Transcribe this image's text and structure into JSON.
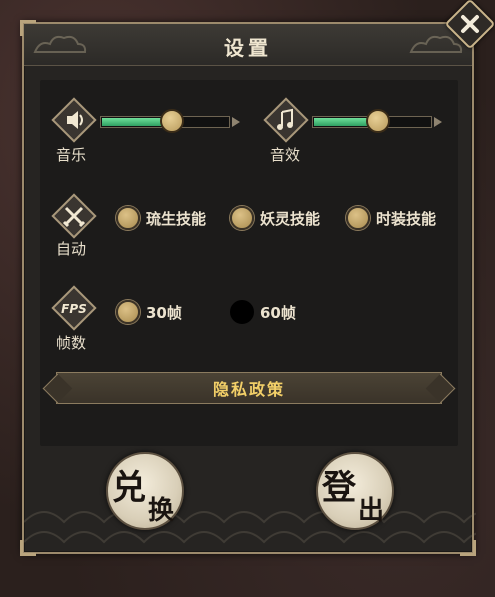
{
  "dialog": {
    "title": "设置"
  },
  "music": {
    "label": "音乐",
    "level": 0.55,
    "icon": "speaker-icon"
  },
  "sound": {
    "label": "音效",
    "level": 0.55,
    "icon": "music-note-icon"
  },
  "auto": {
    "label": "自动",
    "icon": "crossed-swords-icon",
    "options": [
      {
        "label": "琉生技能",
        "selected": true
      },
      {
        "label": "妖灵技能",
        "selected": true
      },
      {
        "label": "时装技能",
        "selected": true
      }
    ]
  },
  "fps": {
    "label": "帧数",
    "icon_text": "FPS",
    "options": [
      {
        "label": "30帧",
        "selected": true
      },
      {
        "label": "60帧",
        "selected": false
      }
    ]
  },
  "privacy": {
    "label": "隐私政策"
  },
  "buttons": {
    "redeem": {
      "chars": [
        "兑",
        "换"
      ]
    },
    "logout": {
      "chars": [
        "登",
        "出"
      ]
    }
  },
  "colors": {
    "accent_gold": "#f2cf68",
    "slider_green": "#3fbf74",
    "frame": "#9c8a6c"
  }
}
